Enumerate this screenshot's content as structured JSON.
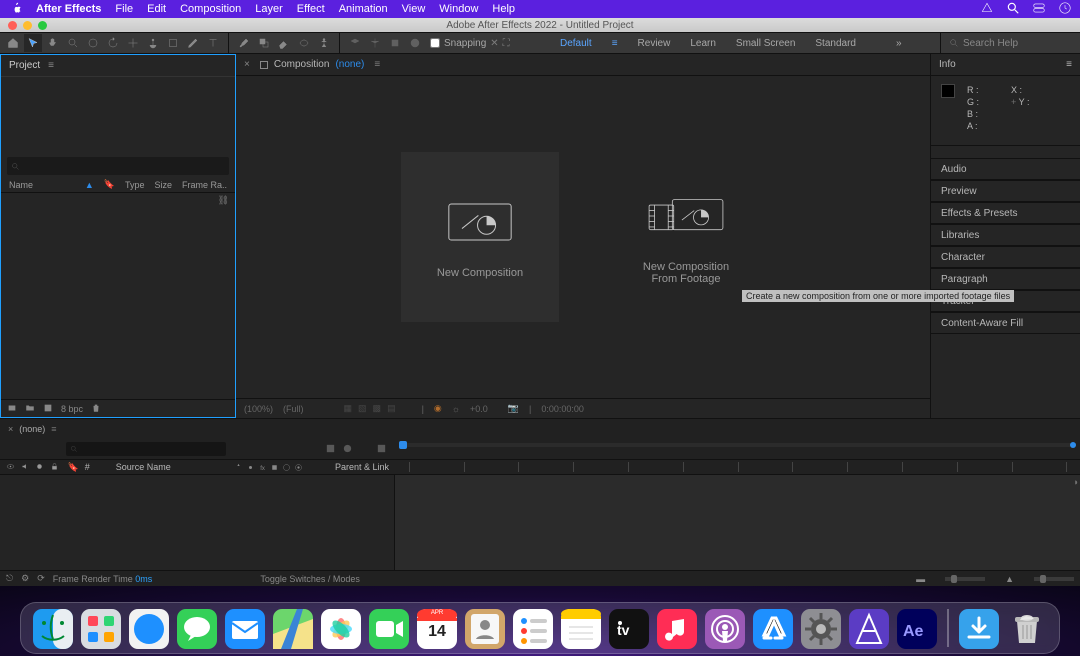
{
  "menubar": {
    "app_name": "After Effects",
    "items": [
      "File",
      "Edit",
      "Composition",
      "Layer",
      "Effect",
      "Animation",
      "View",
      "Window",
      "Help"
    ]
  },
  "titlebar": {
    "title": "Adobe After Effects 2022 - Untitled Project"
  },
  "toolbar": {
    "snapping_label": "Snapping",
    "workspaces": [
      "Default",
      "Review",
      "Learn",
      "Small Screen",
      "Standard"
    ],
    "search_placeholder": "Search Help"
  },
  "project_panel": {
    "tab": "Project",
    "columns": {
      "name": "Name",
      "type": "Type",
      "size": "Size",
      "frame": "Frame Ra.."
    },
    "footer_bpc": "8 bpc"
  },
  "composition_panel": {
    "tab_prefix": "Composition",
    "tab_none": "(none)",
    "new_comp": "New Composition",
    "new_comp_footage_l1": "New Composition",
    "new_comp_footage_l2": "From Footage",
    "tooltip": "Create a new composition from one or more imported footage files",
    "footer": {
      "zoom": "(100%)",
      "res": "(Full)",
      "exposure": "+0.0",
      "timecode": "0:00:00:00"
    }
  },
  "info_panel": {
    "tab": "Info",
    "labels": {
      "r": "R :",
      "g": "G :",
      "b": "B :",
      "a": "A :",
      "x": "X :",
      "y": "Y :"
    }
  },
  "accordion": [
    "Audio",
    "Preview",
    "Effects & Presets",
    "Libraries",
    "Character",
    "Paragraph",
    "Tracker",
    "Content-Aware Fill"
  ],
  "timeline": {
    "tab_none": "(none)",
    "columns": {
      "source": "Source Name",
      "parent": "Parent & Link"
    },
    "footer": {
      "frt_label": "Frame Render Time",
      "frt_value": "0ms",
      "toggle": "Toggle Switches / Modes"
    }
  },
  "dock": {
    "calendar_month": "APR",
    "calendar_day": "14",
    "apps": [
      "finder",
      "launchpad",
      "safari",
      "messages",
      "mail",
      "maps",
      "photos",
      "facetime",
      "calendar",
      "contacts",
      "reminders",
      "notes",
      "appletv",
      "music",
      "podcasts",
      "appstore",
      "settings",
      "affinity",
      "aftereffects"
    ],
    "right": [
      "downloads",
      "trash"
    ]
  }
}
